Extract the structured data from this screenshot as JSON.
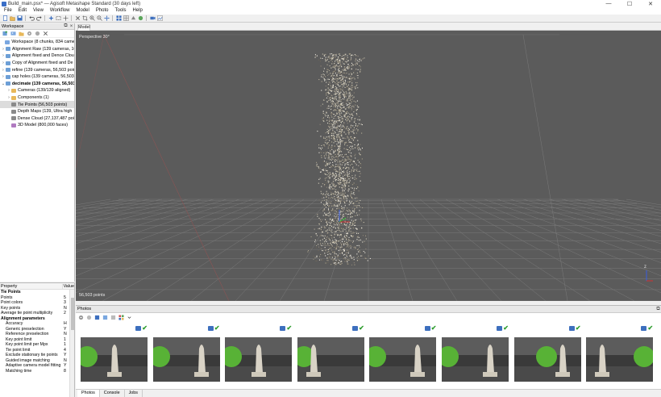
{
  "window": {
    "title": "Build_main.psx* — Agisoft Metashape Standard (30 days left)"
  },
  "menu": [
    "File",
    "Edit",
    "View",
    "Workflow",
    "Model",
    "Photo",
    "Tools",
    "Help"
  ],
  "workspace": {
    "title": "Workspace",
    "items": [
      {
        "label": "Workspace (8 chunks, 834 cameras)",
        "level": 0,
        "expander": "",
        "icon": "workspace",
        "color": "#7aa7e0"
      },
      {
        "label": "Alignment Raw (139 cameras, 10",
        "level": 0,
        "expander": "›",
        "icon": "chunk",
        "color": "#6d9fd6"
      },
      {
        "label": "Alignment fixed and Dence Cloud",
        "level": 0,
        "expander": "›",
        "icon": "chunk",
        "color": "#6d9fd6"
      },
      {
        "label": "Copy of Alignment fixed and De",
        "level": 0,
        "expander": "›",
        "icon": "chunk",
        "color": "#6d9fd6"
      },
      {
        "label": "refine (139 cameras, 56,503 point",
        "level": 0,
        "expander": "›",
        "icon": "chunk",
        "color": "#6d9fd6"
      },
      {
        "label": "cap holes (139 cameras, 56,503 p",
        "level": 0,
        "expander": "›",
        "icon": "chunk",
        "color": "#6d9fd6"
      },
      {
        "label": "decimate (139 cameras, 56,503",
        "level": 0,
        "expander": "⌄",
        "icon": "chunk",
        "color": "#6d9fd6",
        "bold": true
      },
      {
        "label": "Cameras (139/139 aligned)",
        "level": 1,
        "expander": "›",
        "icon": "folder",
        "color": "#e8b85a"
      },
      {
        "label": "Components (1)",
        "level": 1,
        "expander": "›",
        "icon": "folder",
        "color": "#e8b85a"
      },
      {
        "label": "Tie Points (56,503 points)",
        "level": 1,
        "expander": "",
        "icon": "tie-points",
        "color": "#8a8a8a",
        "selected": true
      },
      {
        "label": "Depth Maps (139, Ultra high",
        "level": 1,
        "expander": "",
        "icon": "depth-maps",
        "color": "#8a8a8a"
      },
      {
        "label": "Dense Cloud (27,137,487 poin",
        "level": 1,
        "expander": "",
        "icon": "dense-cloud",
        "color": "#8a8a8a"
      },
      {
        "label": "3D Model (800,000 faces)",
        "level": 1,
        "expander": "",
        "icon": "model",
        "color": "#b07ac0"
      }
    ]
  },
  "property": {
    "header": "Property",
    "value_header": "Value",
    "rows": [
      {
        "name": "Tie Points",
        "value": "",
        "type": "section"
      },
      {
        "name": "Points",
        "value": "5",
        "type": "row"
      },
      {
        "name": "Point colors",
        "value": "3",
        "type": "row"
      },
      {
        "name": "Key points",
        "value": "N",
        "type": "row"
      },
      {
        "name": "Average tie point multiplicity",
        "value": "2",
        "type": "row"
      },
      {
        "name": "Alignment parameters",
        "value": "",
        "type": "section"
      },
      {
        "name": "Accuracy",
        "value": "H",
        "type": "indent"
      },
      {
        "name": "Generic preselection",
        "value": "Y",
        "type": "indent"
      },
      {
        "name": "Reference preselection",
        "value": "N",
        "type": "indent"
      },
      {
        "name": "Key point limit",
        "value": "1",
        "type": "indent"
      },
      {
        "name": "Key point limit per Mpx",
        "value": "1",
        "type": "indent"
      },
      {
        "name": "Tie point limit",
        "value": "4",
        "type": "indent"
      },
      {
        "name": "Exclude stationary tie points",
        "value": "Y",
        "type": "indent"
      },
      {
        "name": "Guided image matching",
        "value": "N",
        "type": "indent"
      },
      {
        "name": "Adaptive camera model fitting",
        "value": "Y",
        "type": "indent"
      },
      {
        "name": "Matching time",
        "value": "8",
        "type": "indent"
      }
    ]
  },
  "model_view": {
    "tab": "Model",
    "projection_label": "Perspective 30°",
    "point_count": "56,503 points",
    "background": "#5b5b5b"
  },
  "photos": {
    "title": "Photos",
    "thumbnails": [
      {
        "ball_side": "left",
        "statue_side": "center"
      },
      {
        "ball_side": "left",
        "statue_side": "right"
      },
      {
        "ball_side": "left",
        "statue_side": "center"
      },
      {
        "ball_side": "left",
        "statue_side": "left"
      },
      {
        "ball_side": "left",
        "statue_side": "right"
      },
      {
        "ball_side": "left",
        "statue_side": "right"
      },
      {
        "ball_side": "center",
        "statue_side": "right"
      },
      {
        "ball_side": "right",
        "statue_side": "left"
      }
    ],
    "check_color": "#2e9d2e"
  },
  "bottom_tabs": [
    "Photos",
    "Console",
    "Jobs"
  ]
}
